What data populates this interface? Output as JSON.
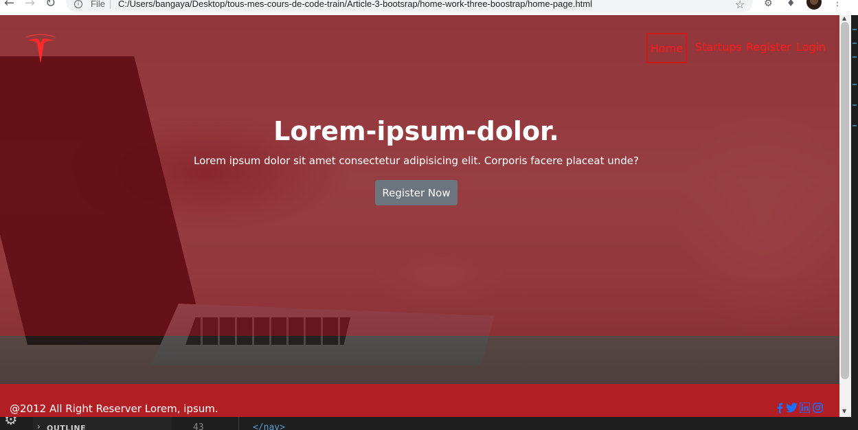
{
  "browser": {
    "file_label": "File",
    "url": "C:/Users/bangaya/Desktop/tous-mes-cours-de-code-train/Article-3-bootsrap/home-work-three-boostrap/home-page.html"
  },
  "page": {
    "nav": {
      "items": [
        {
          "label": "Home",
          "active": true
        },
        {
          "label": "Startups"
        },
        {
          "label": "Register"
        },
        {
          "label": "Login"
        }
      ]
    },
    "hero": {
      "title": "Lorem-ipsum-dolor.",
      "subtitle": "Lorem ipsum dolor sit amet consectetur adipisicing elit. Corporis facere placeat unde?",
      "button_label": "Register Now"
    },
    "footer": {
      "text": "@2012 All Right Reserver Lorem, ipsum.",
      "social_icons": [
        "facebook-icon",
        "twitter-icon",
        "linkedin-icon",
        "instagram-icon"
      ]
    }
  },
  "editor": {
    "outline_label": "OUTLINE",
    "line_number": "43",
    "code": "</nav>"
  },
  "colors": {
    "overlay": "#780a12",
    "footer": "#b11f24",
    "nav_link": "#ff1a1a",
    "button": "#6c757d",
    "social": "#1e6fff"
  }
}
